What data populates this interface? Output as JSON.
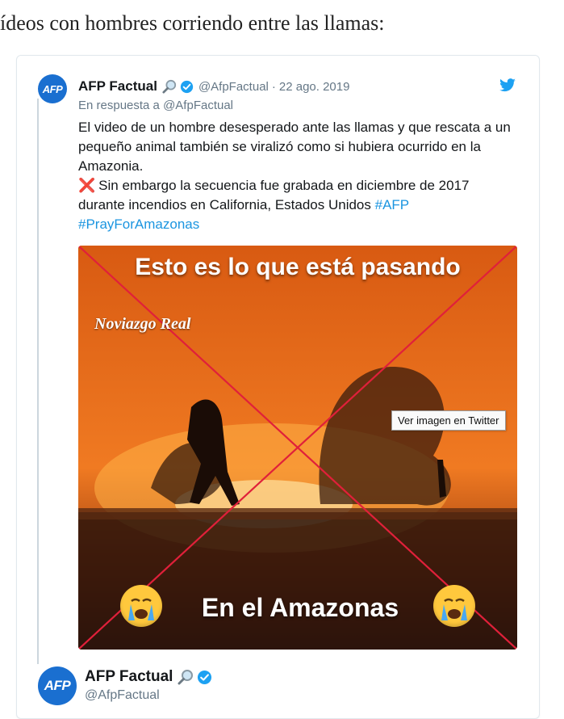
{
  "intro_text": "ídeos con hombres corriendo entre las llamas:",
  "tweet": {
    "avatar_text": "AFP",
    "name": "AFP Factual",
    "handle": "@AfpFactual",
    "separator": "·",
    "date": "22 ago. 2019",
    "reply_prefix": "En respuesta a",
    "reply_to": "@AfpFactual",
    "paragraph1": "El video de un hombre desesperado ante las llamas y que rescata a un pequeño animal también se viralizó como si hubiera ocurrido en la Amazonia.",
    "cross_mark": "❌",
    "paragraph2": "Sin embargo la secuencia fue grabada en diciembre de 2017 durante incendios en California, Estados Unidos",
    "hashtag1": "#AFP",
    "hashtag2": "#PrayForAmazonas"
  },
  "media": {
    "caption_top": "Esto es lo que está pasando",
    "watermark": "Noviazgo Real",
    "caption_bottom": "En el Amazonas",
    "tooltip": "Ver imagen en Twitter",
    "cross_color": "#e0203a"
  },
  "second_tweet": {
    "avatar_text": "AFP",
    "name": "AFP Factual",
    "handle": "@AfpFactual"
  },
  "colors": {
    "accent": "#1b95e0",
    "verified": "#1da1f2",
    "muted": "#657786",
    "avatar": "#1a6fd0"
  },
  "icons": {
    "verified": "verified-badge-icon",
    "magnifier": "magnifying-glass-icon",
    "twitter": "twitter-bird-icon",
    "emoji": "crying-face-emoji-icon"
  }
}
